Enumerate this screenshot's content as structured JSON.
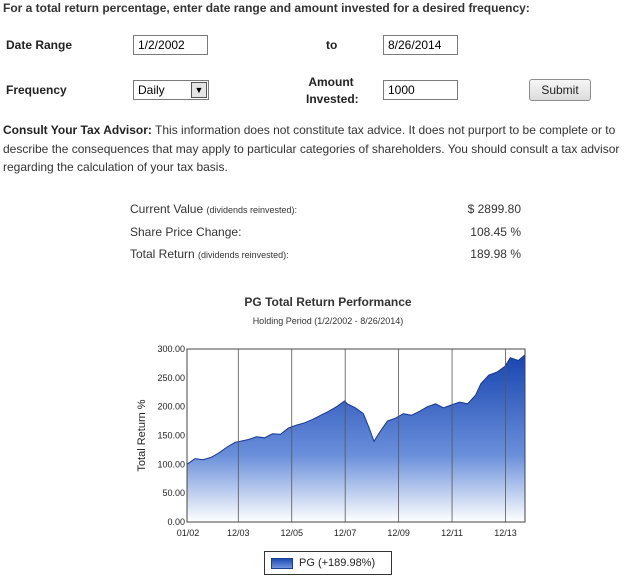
{
  "intro": "For a total return percentage, enter date range and amount invested for a desired frequency:",
  "form": {
    "date_range_label": "Date Range",
    "start_date": "1/2/2002",
    "to_label": "to",
    "end_date": "8/26/2014",
    "frequency_label": "Frequency",
    "frequency_value": "Daily",
    "amount_label_line1": "Amount",
    "amount_label_line2": "Invested:",
    "amount_value": "1000",
    "submit_label": "Submit"
  },
  "disclaimer": {
    "heading": "Consult Your Tax Advisor:",
    "text": " This information does not constitute tax advice. It does not purport to be complete or to describe the consequences that may apply to particular categories of shareholders. You should consult a tax advisor regarding the calculation of your tax basis."
  },
  "summary": {
    "current_value_label": "Current Value",
    "current_value_note": "(dividends reinvested):",
    "current_value": "$ 2899.80",
    "share_price_label": "Share Price Change:",
    "share_price_value": "108.45 %",
    "total_return_label": "Total Return",
    "total_return_note": "(dividends reinvested):",
    "total_return_value": "189.98 %"
  },
  "chart_data": {
    "type": "area",
    "title": "PG Total Return Performance",
    "subtitle": "Holding Period (1/2/2002 - 8/26/2014)",
    "ylabel": "Total Return %",
    "ylim": [
      0,
      300
    ],
    "y_ticks": [
      "0.00",
      "50.00",
      "100.00",
      "150.00",
      "200.00",
      "250.00",
      "300.00"
    ],
    "x_ticks": [
      "01/02",
      "12/03",
      "12/05",
      "12/07",
      "12/09",
      "12/11",
      "12/13"
    ],
    "x_tick_years": [
      2002.0,
      2003.92,
      2005.92,
      2007.92,
      2009.92,
      2011.92,
      2013.92
    ],
    "xlim": [
      2002.0,
      2014.65
    ],
    "grid": "vertical",
    "series": [
      {
        "name": "PG (+189.98%)",
        "color": "#1d4cb5",
        "x": [
          2002.0,
          2002.3,
          2002.6,
          2002.9,
          2003.2,
          2003.5,
          2003.8,
          2004.0,
          2004.3,
          2004.6,
          2004.9,
          2005.2,
          2005.5,
          2005.8,
          2006.1,
          2006.4,
          2006.7,
          2007.0,
          2007.3,
          2007.6,
          2007.9,
          2008.0,
          2008.3,
          2008.6,
          2008.8,
          2009.0,
          2009.2,
          2009.5,
          2009.8,
          2010.1,
          2010.4,
          2010.7,
          2011.0,
          2011.3,
          2011.6,
          2011.9,
          2012.2,
          2012.5,
          2012.8,
          2013.0,
          2013.3,
          2013.6,
          2013.9,
          2014.1,
          2014.4,
          2014.65
        ],
        "values": [
          100,
          110,
          108,
          112,
          120,
          130,
          138,
          140,
          143,
          148,
          146,
          153,
          152,
          163,
          168,
          172,
          178,
          185,
          192,
          200,
          210,
          205,
          198,
          188,
          165,
          140,
          155,
          175,
          180,
          188,
          185,
          192,
          200,
          205,
          198,
          203,
          208,
          205,
          220,
          240,
          255,
          260,
          270,
          285,
          280,
          290
        ]
      }
    ]
  }
}
